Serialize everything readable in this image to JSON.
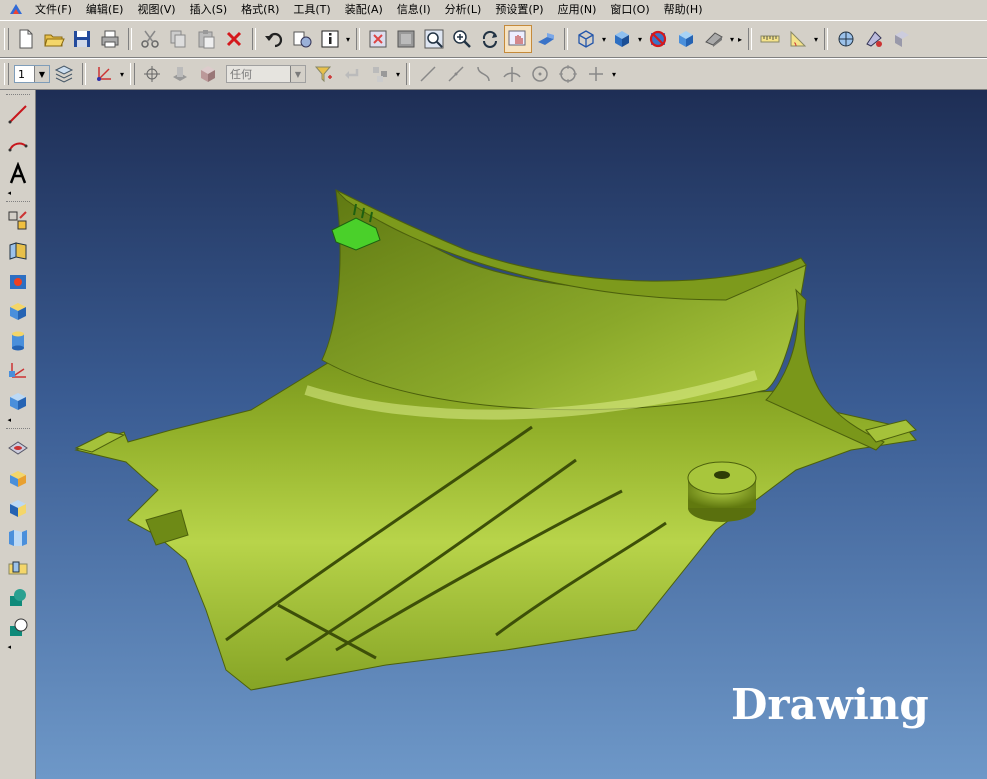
{
  "menu": {
    "items": [
      "文件(F)",
      "编辑(E)",
      "视图(V)",
      "插入(S)",
      "格式(R)",
      "工具(T)",
      "装配(A)",
      "信息(I)",
      "分析(L)",
      "预设置(P)",
      "应用(N)",
      "窗口(O)",
      "帮助(H)"
    ]
  },
  "toolbar2": {
    "layer_value": "1",
    "filter_placeholder": "任何"
  },
  "viewport": {
    "label": "Drawing",
    "part_color": "#8aa82a",
    "background_top": "#1e2e55",
    "background_bottom": "#6e98c8"
  }
}
